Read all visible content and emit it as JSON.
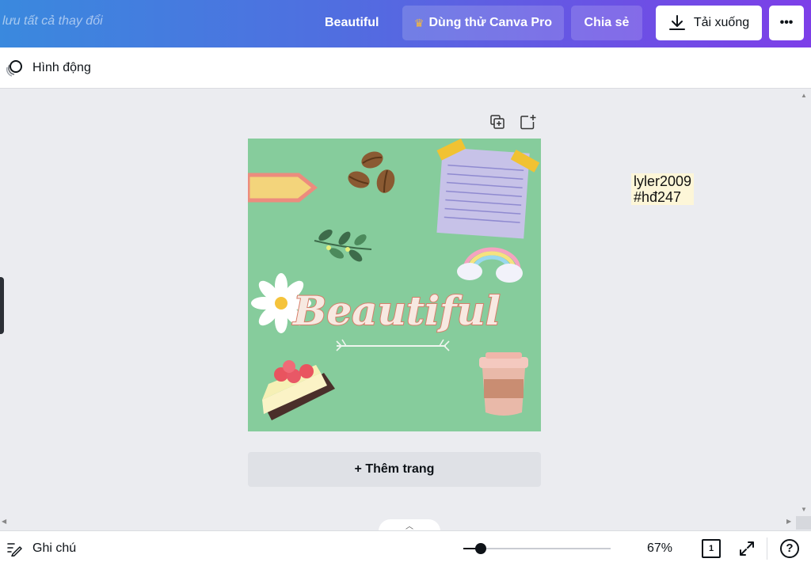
{
  "header": {
    "save_status": "lưu tất cả thay đổi",
    "design_title": "Beautiful",
    "pro_label": "Dùng thử Canva Pro",
    "share_label": "Chia sẻ",
    "download_label": "Tải xuống",
    "more_label": "•••"
  },
  "toolbar": {
    "animate_label": "Hình động"
  },
  "canvas": {
    "design_text": "Beautiful",
    "add_page_label": "+ Thêm trang",
    "background_color": "#86cc9c"
  },
  "watermark": {
    "line1": "lyler2009",
    "line2": "#hđ247"
  },
  "footer": {
    "notes_label": "Ghi chú",
    "zoom_label": "67%",
    "zoom_fraction": 0.12,
    "page_number": "1",
    "help_label": "?"
  },
  "icons": [
    "crown-icon",
    "download-icon",
    "animate-icon",
    "duplicate-page-icon",
    "add-page-icon",
    "notes-icon",
    "fullscreen-icon",
    "help-icon"
  ]
}
